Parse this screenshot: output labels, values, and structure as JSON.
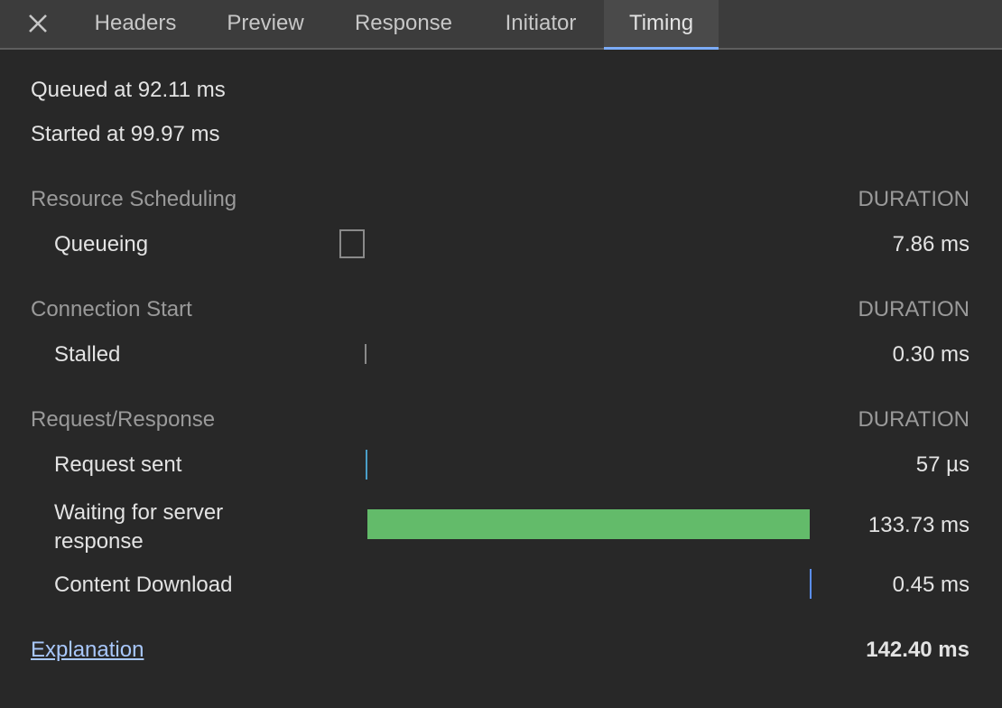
{
  "tabs": [
    {
      "label": "Headers",
      "active": false
    },
    {
      "label": "Preview",
      "active": false
    },
    {
      "label": "Response",
      "active": false
    },
    {
      "label": "Initiator",
      "active": false
    },
    {
      "label": "Timing",
      "active": true
    }
  ],
  "close_icon": "close-icon",
  "queued_at": "Queued at 92.11 ms",
  "started_at": "Started at 99.97 ms",
  "sections": [
    {
      "title": "Resource Scheduling",
      "duration_label": "DURATION",
      "rows": [
        {
          "label": "Queueing",
          "value": "7.86 ms"
        }
      ]
    },
    {
      "title": "Connection Start",
      "duration_label": "DURATION",
      "rows": [
        {
          "label": "Stalled",
          "value": "0.30 ms"
        }
      ]
    },
    {
      "title": "Request/Response",
      "duration_label": "DURATION",
      "rows": [
        {
          "label": "Request sent",
          "value": "57 µs"
        },
        {
          "label": "Waiting for server response",
          "value": "133.73 ms"
        },
        {
          "label": "Content Download",
          "value": "0.45 ms"
        }
      ]
    }
  ],
  "explanation_link": "Explanation",
  "total": "142.40 ms",
  "colors": {
    "accent": "#7cacf8",
    "waiting": "#63bb6a",
    "request_sent": "#4a9fc9",
    "content_download": "#5b8ef5",
    "stalled": "#8a8a8a"
  }
}
